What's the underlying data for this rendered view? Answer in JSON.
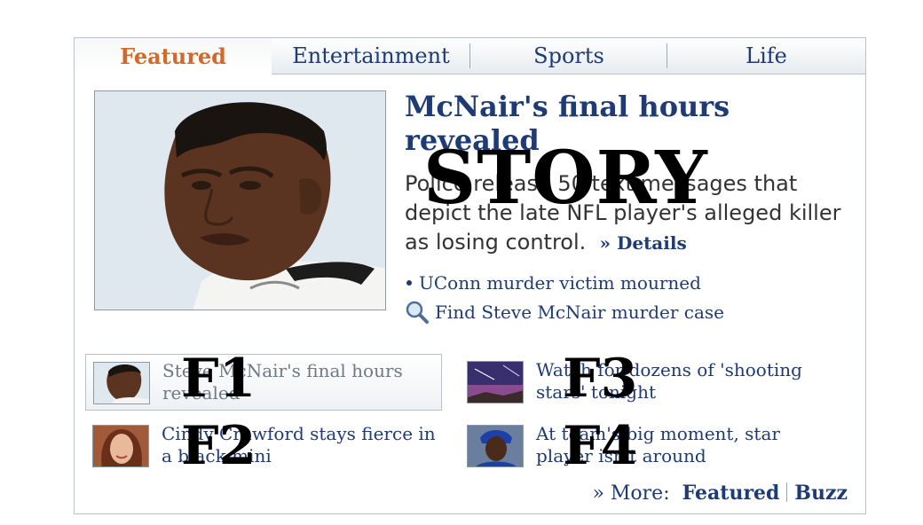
{
  "tabs": [
    {
      "label": "Featured",
      "active": true
    },
    {
      "label": "Entertainment",
      "active": false
    },
    {
      "label": "Sports",
      "active": false
    },
    {
      "label": "Life",
      "active": false
    }
  ],
  "story": {
    "headline": "McNair's final hours revealed",
    "summary": "Police release 50 text messages that depict the late NFL player's alleged killer as losing control.",
    "details_label": "» Details",
    "overlay_label": "STORY",
    "links": [
      {
        "text": "UConn murder victim mourned",
        "icon": "bullet"
      },
      {
        "text": "Find Steve McNair murder case",
        "icon": "magnifier-icon"
      }
    ]
  },
  "features": [
    {
      "text": "Steve McNair's final hours revealed",
      "overlay": "F1",
      "active": true
    },
    {
      "text": "Cindy Crawford stays fierce in a black mini",
      "overlay": "F2",
      "active": false
    },
    {
      "text": "Watch for dozens of 'shooting stars' tonight",
      "overlay": "F3",
      "active": false
    },
    {
      "text": "At team's big moment, star player isn't around",
      "overlay": "F4",
      "active": false
    }
  ],
  "more": {
    "prefix": "» More:",
    "links": [
      "Featured",
      "Buzz"
    ]
  },
  "colors": {
    "link": "#1f3b74",
    "active_tab": "#d2692a",
    "border": "#b7c3cd"
  }
}
